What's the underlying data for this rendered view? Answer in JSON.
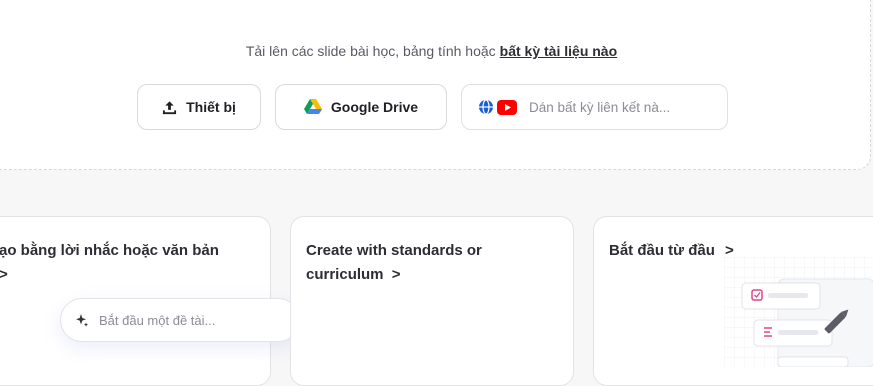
{
  "upload": {
    "prompt_text": "Tải lên các slide bài học, bảng tính hoặc",
    "prompt_link": "bất kỳ tài liệu nào",
    "device_button": "Thiết bị",
    "drive_button": "Google Drive",
    "link_placeholder": "Dán bất kỳ liên kết nà..."
  },
  "cards": {
    "prompt_card_title": "ạo bằng lời nhắc hoặc văn bản",
    "prompt_card_chevron": ">",
    "topic_placeholder": "Bắt đầu một đề tài...",
    "standards_card_title": "Create with standards or curriculum",
    "standards_card_chevron": ">",
    "scratch_card_title": "Bắt đầu từ đầu",
    "scratch_card_chevron": ">"
  },
  "colors": {
    "accent_pink": "#e8408a",
    "youtube_red": "#ff0000",
    "globe_blue": "#1a5fd0"
  }
}
